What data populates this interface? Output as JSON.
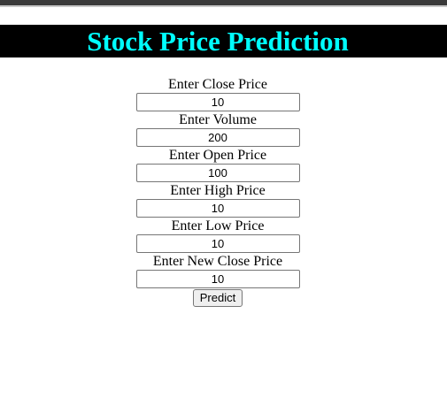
{
  "page": {
    "title": "Stock Price Prediction",
    "title_color": "#00ffff",
    "header_background": "#000000"
  },
  "form": {
    "fields": [
      {
        "label": "Enter Close Price",
        "value": "10"
      },
      {
        "label": "Enter Volume",
        "value": "200"
      },
      {
        "label": "Enter Open Price",
        "value": "100"
      },
      {
        "label": "Enter High Price",
        "value": "10"
      },
      {
        "label": "Enter Low Price",
        "value": "10"
      },
      {
        "label": "Enter New Close Price",
        "value": "10"
      }
    ],
    "submit_label": "Predict"
  }
}
